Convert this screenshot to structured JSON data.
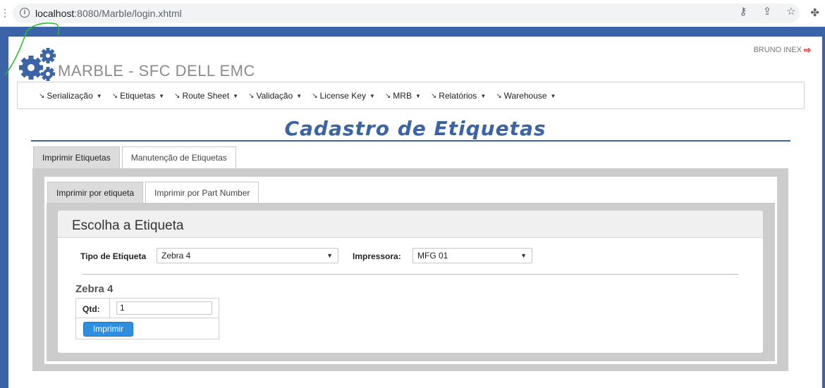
{
  "browser": {
    "url_host": "localhost",
    "url_path": ":8080/Marble/login.xhtml",
    "icons": [
      "key-icon",
      "share-icon",
      "star-icon",
      "extensions-icon"
    ]
  },
  "header": {
    "app_title": "MARBLE - SFC DELL EMC",
    "user_name": "BRUNO INEX"
  },
  "menu": {
    "items": [
      {
        "label": "Serialização"
      },
      {
        "label": "Etiquetas"
      },
      {
        "label": "Route Sheet"
      },
      {
        "label": "Validação"
      },
      {
        "label": "License Key"
      },
      {
        "label": "MRB"
      },
      {
        "label": "Relatórios"
      },
      {
        "label": "Warehouse"
      }
    ]
  },
  "page": {
    "title": "Cadastro de Etiquetas"
  },
  "outer_tabs": [
    {
      "label": "Imprimir Etiquetas",
      "active": true
    },
    {
      "label": "Manutenção de Etiquetas",
      "active": false
    }
  ],
  "inner_tabs": [
    {
      "label": "Imprimir por etiqueta",
      "active": true
    },
    {
      "label": "Imprimir por Part Number",
      "active": false
    }
  ],
  "card": {
    "title": "Escolha a Etiqueta",
    "tipo_label": "Tipo de Etiqueta",
    "tipo_value": "Zebra 4",
    "impressora_label": "Impressora:",
    "impressora_value": "MFG 01",
    "subtitle": "Zebra 4",
    "qtd_label": "Qtd:",
    "qtd_value": "1",
    "print_label": "Imprimir"
  },
  "colors": {
    "brand_blue": "#3a63a8",
    "button_blue": "#2d8fe0",
    "logout_red": "#d9261c",
    "scribble_green": "#22c322"
  }
}
